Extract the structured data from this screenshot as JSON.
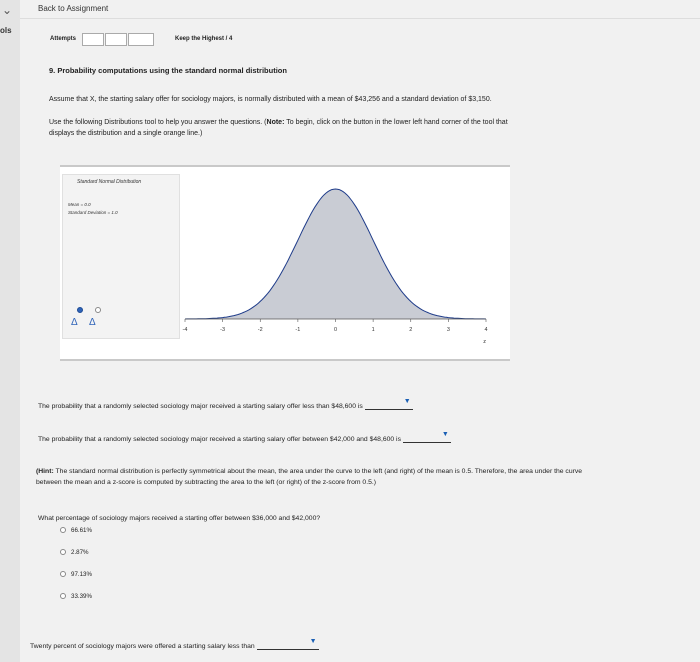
{
  "nav": {
    "back_label": "Back to Assignment",
    "side_label": "ols"
  },
  "attempts": {
    "label": "Attempts",
    "keep_label": "Keep the Highest / 4"
  },
  "question": {
    "title": "9. Probability computations using the standard normal distribution",
    "intro": "Assume that X, the starting salary offer for sociology majors, is normally distributed with a mean of $43,256 and a standard deviation of $3,150.",
    "instr_1": "Use the following Distributions tool to help you answer the questions. (",
    "instr_note": "Note:",
    "instr_2": " To begin, click on the button in the lower left hand corner of the tool that",
    "instr_3": "displays the distribution and a single orange line.)"
  },
  "tool": {
    "title": "Standard Normal Distribution",
    "mean_line": "Mean = 0.0",
    "sd_line": "Standard Deviation = 1.0",
    "axis_label": "z",
    "ticks": [
      "-4",
      "-3",
      "-2",
      "-1",
      "0",
      "1",
      "2",
      "3",
      "4"
    ]
  },
  "chart_data": {
    "type": "area",
    "title": "Standard Normal Distribution",
    "xlabel": "z",
    "ylabel": "",
    "xlim": [
      -4,
      4
    ],
    "mean": 0.0,
    "sd": 1.0,
    "x": [
      -4,
      -3,
      -2,
      -1,
      0,
      1,
      2,
      3,
      4
    ],
    "series": [
      {
        "values": [
          0.0001,
          0.0044,
          0.054,
          0.242,
          0.399,
          0.242,
          0.054,
          0.0044,
          0.0001
        ]
      }
    ],
    "colors": {
      "fill": "#c9ccd4",
      "line": "#1f3c8a"
    }
  },
  "sentences": {
    "s1": "The probability that a randomly selected sociology major received a starting salary offer less than $48,600 is",
    "s2": "The probability that a randomly selected sociology major received a starting salary offer between $42,000 and $48,600 is",
    "hint_label": "(Hint:",
    "hint_text": " The standard normal distribution is perfectly symmetrical about the mean, the area under the curve to the left (and right) of the mean is 0.5. Therefore, the area under the curve between the mean and a z-score is computed by subtracting the area to the left (or right) of the z-score from 0.5.)",
    "mc_question": "What percentage of sociology majors received a starting offer between $36,000 and $42,000?",
    "options": [
      "66.61%",
      "2.87%",
      "97.13%",
      "33.39%"
    ],
    "last": "Twenty percent of sociology majors were offered a starting salary less than"
  }
}
